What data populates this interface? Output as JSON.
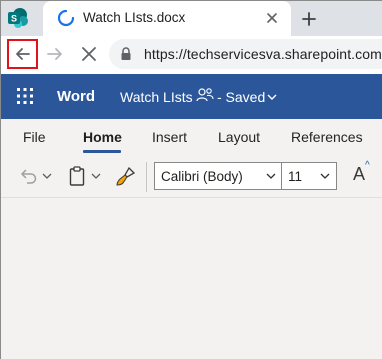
{
  "browser": {
    "tab_title": "Watch LIsts.docx",
    "url": "https://techservicesva.sharepoint.com/"
  },
  "word": {
    "app_name": "Word",
    "doc_title": "Watch LIsts",
    "doc_status": "- Saved",
    "brand_color": "#2b579a"
  },
  "ribbon": {
    "tabs": [
      {
        "label": "File"
      },
      {
        "label": "Home"
      },
      {
        "label": "Insert"
      },
      {
        "label": "Layout"
      },
      {
        "label": "References"
      }
    ],
    "active_tab": "Home",
    "font_name": "Calibri (Body)",
    "font_size": "11",
    "grow_font_label": "A",
    "grow_font_caret": "^"
  },
  "icons": {
    "back": "back-arrow-icon",
    "forward": "forward-arrow-icon",
    "stop": "stop-loading-icon",
    "lock": "lock-icon",
    "waffle": "app-launcher-icon",
    "share": "shared-users-icon",
    "undo": "undo-icon",
    "paste": "clipboard-paste-icon",
    "format_painter": "format-painter-icon"
  }
}
